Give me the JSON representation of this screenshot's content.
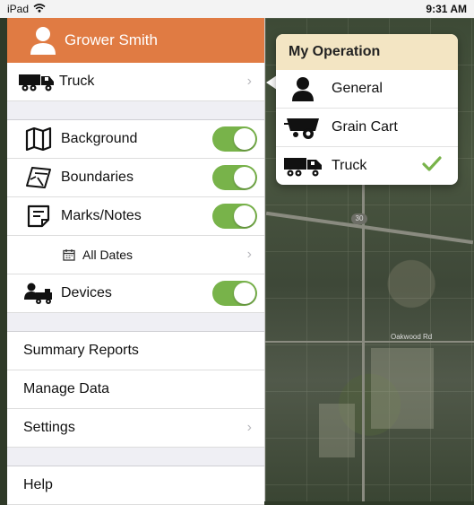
{
  "status_bar": {
    "device": "iPad",
    "time": "9:31 AM"
  },
  "user": {
    "name": "Grower Smith"
  },
  "vehicle_row": {
    "label": "Truck"
  },
  "layers": [
    {
      "label": "Background",
      "on": true
    },
    {
      "label": "Boundaries",
      "on": true
    },
    {
      "label": "Marks/Notes",
      "on": true
    }
  ],
  "dates_row": {
    "label": "All Dates"
  },
  "devices_row": {
    "label": "Devices",
    "on": true
  },
  "menu_items": {
    "summary": "Summary Reports",
    "manage": "Manage Data",
    "settings": "Settings",
    "help": "Help"
  },
  "popover": {
    "title": "My Operation",
    "options": [
      {
        "label": "General",
        "selected": false
      },
      {
        "label": "Grain Cart",
        "selected": false
      },
      {
        "label": "Truck",
        "selected": true
      }
    ]
  },
  "map": {
    "highway_shield": "30",
    "road_label": "Oakwood Rd"
  },
  "colors": {
    "header": "#e07b43",
    "toggle_on": "#78b34a",
    "popover_header": "#f3e5c3",
    "check": "#78b34a"
  }
}
